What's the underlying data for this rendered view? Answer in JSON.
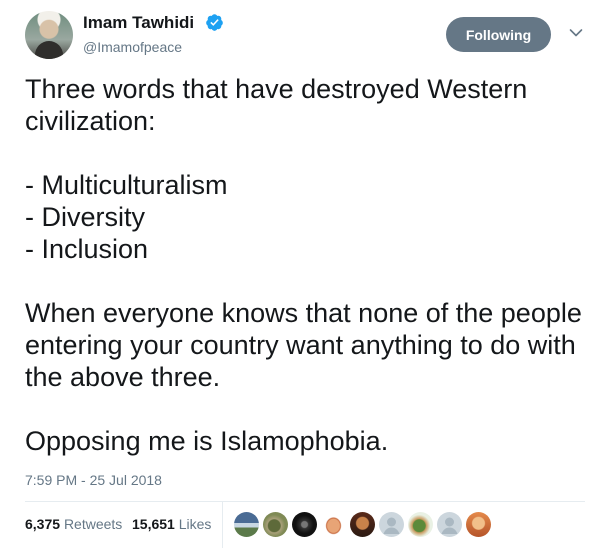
{
  "author": {
    "name": "Imam Tawhidi",
    "handle": "@Imamofpeace",
    "verified": true,
    "verified_color": "#1da1f2"
  },
  "follow_button": {
    "label": "Following",
    "color": "#657786"
  },
  "menu_icon": "chevron-down-icon",
  "tweet": {
    "text": "Three words that have destroyed Western civilization:\n\n- Multiculturalism\n- Diversity\n- Inclusion\n\nWhen everyone knows that none of the people entering your country want anything to do with the above three.\n\nOpposing me is Islamophobia.",
    "timestamp": "7:59 PM - 25 Jul 2018"
  },
  "stats": {
    "retweets_count": "6,375",
    "retweets_label": "Retweets",
    "likes_count": "15,651",
    "likes_label": "Likes"
  },
  "likers": [
    {
      "kind": "landscape",
      "colors": [
        "#4a6b94",
        "#c8d7e3",
        "#5b7a4a"
      ]
    },
    {
      "kind": "animal",
      "colors": [
        "#7f8a55",
        "#5e6a3a",
        "#a9a07a"
      ]
    },
    {
      "kind": "dark",
      "colors": [
        "#111111",
        "#333333",
        "#777777"
      ]
    },
    {
      "kind": "hand",
      "colors": [
        "#ffffff",
        "#e8a476",
        "#c86a3f"
      ]
    },
    {
      "kind": "person",
      "colors": [
        "#5a2a1a",
        "#c8824a",
        "#2b1a12"
      ]
    },
    {
      "kind": "default",
      "colors": [
        "#ccd6dd",
        "#aab8c2",
        "#ccd6dd"
      ]
    },
    {
      "kind": "cartoon",
      "colors": [
        "#e9f1e4",
        "#5c8a3a",
        "#c99b60"
      ]
    },
    {
      "kind": "default",
      "colors": [
        "#ccd6dd",
        "#aab8c2",
        "#ccd6dd"
      ]
    },
    {
      "kind": "person",
      "colors": [
        "#e58a4a",
        "#f2c08a",
        "#b5542a"
      ]
    }
  ]
}
